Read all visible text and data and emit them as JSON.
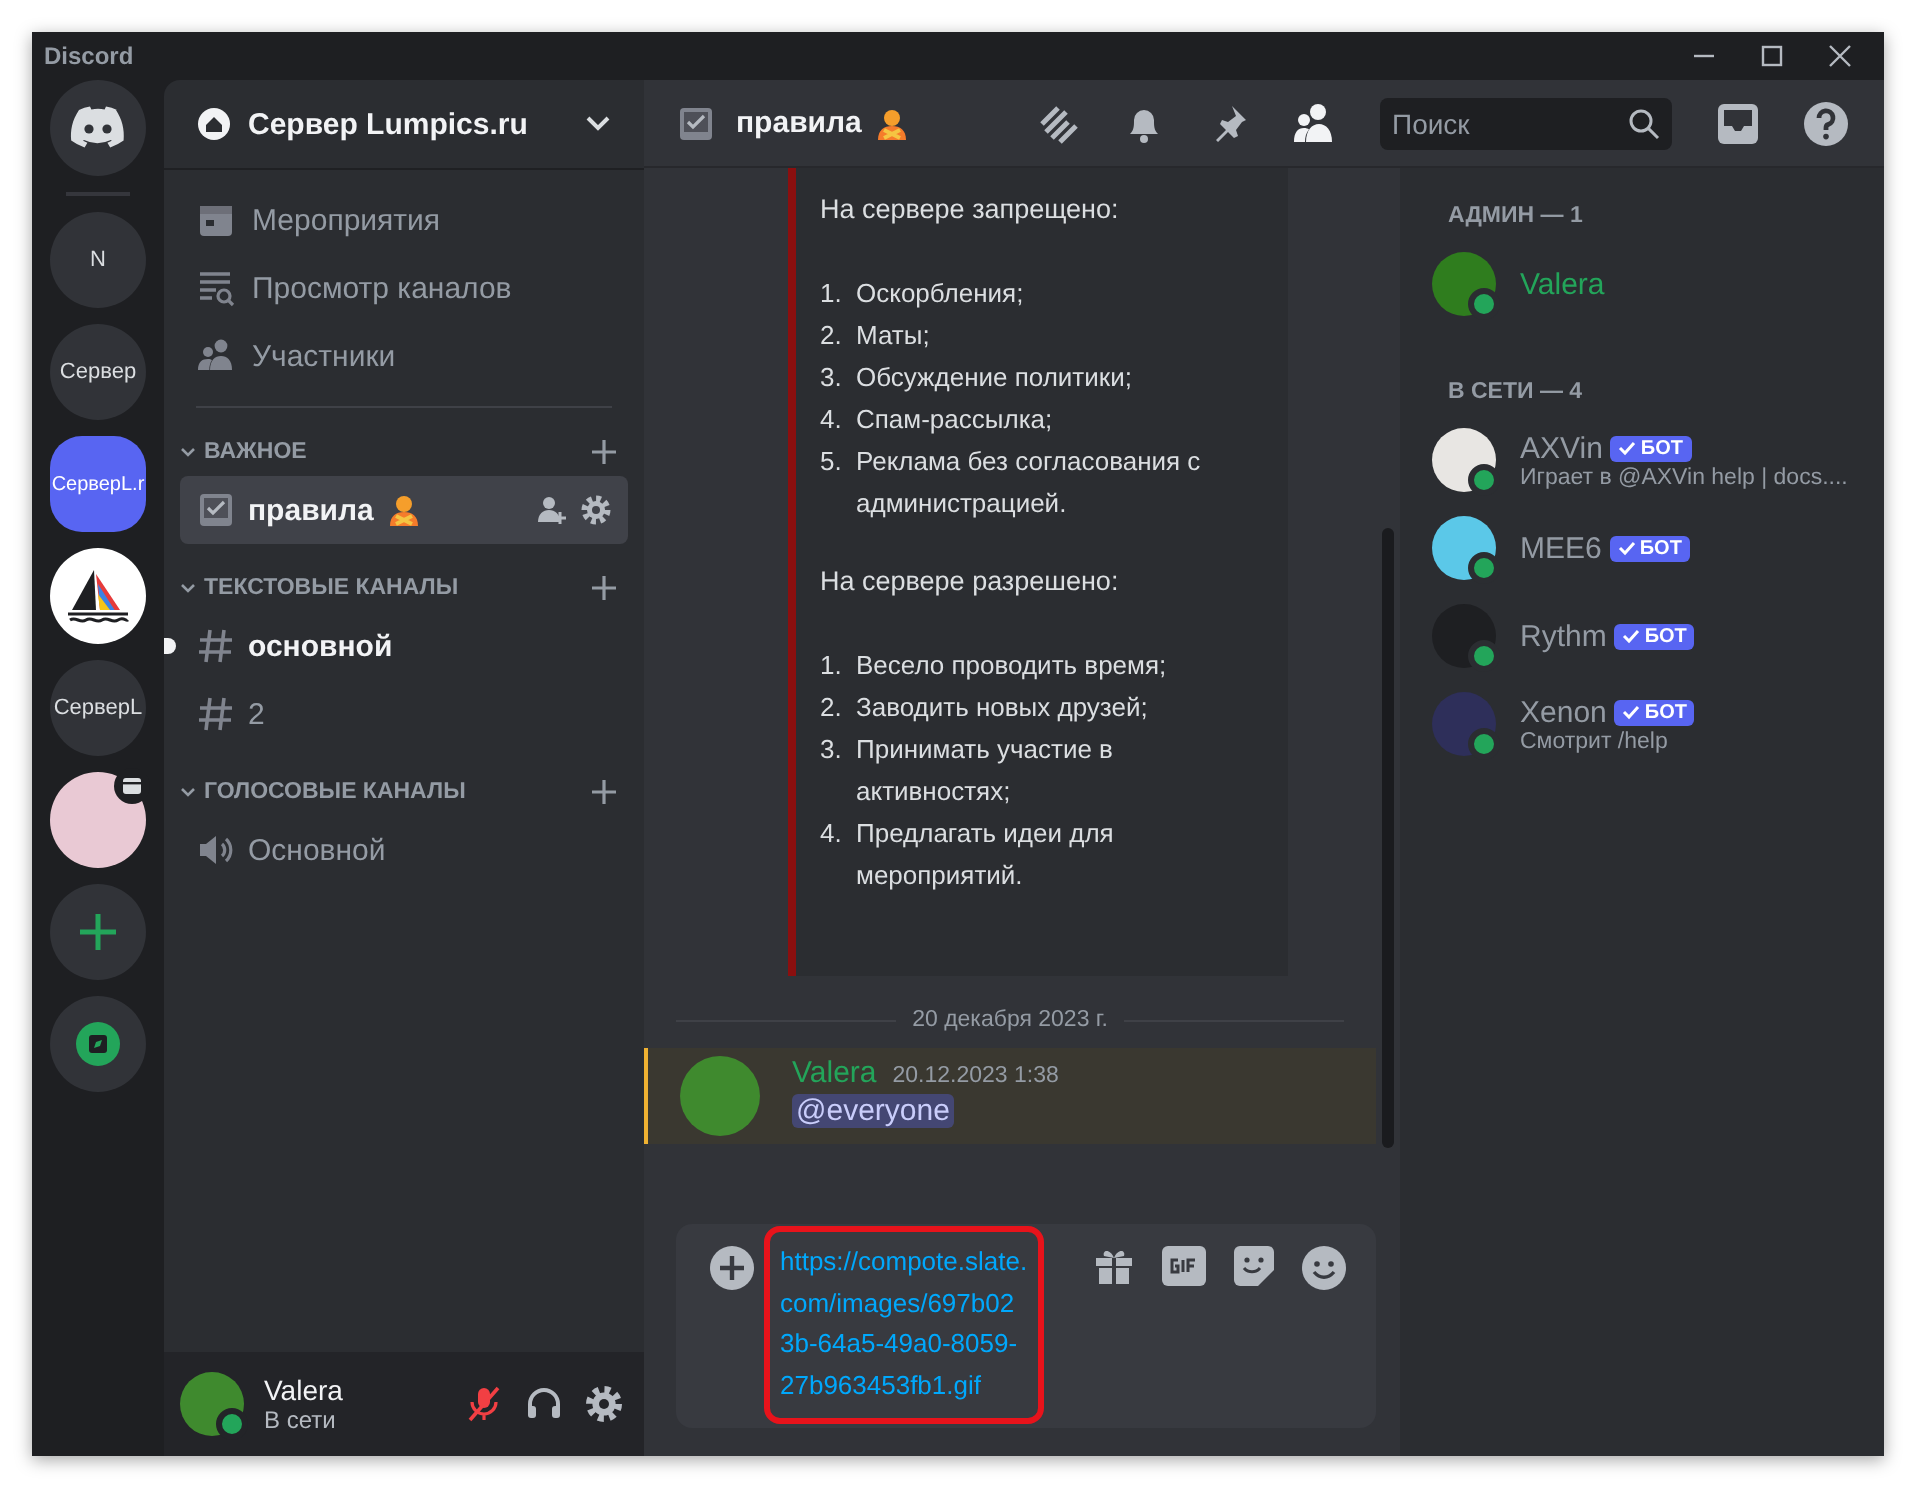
{
  "window": {
    "title": "Discord"
  },
  "servers": [
    {
      "kind": "home",
      "selected": false
    },
    {
      "kind": "text",
      "label": "N",
      "selected": false
    },
    {
      "kind": "text",
      "label": "Сервер",
      "selected": false
    },
    {
      "kind": "text",
      "label": "СерверL.r",
      "selected": true
    },
    {
      "kind": "image",
      "selected": false
    },
    {
      "kind": "text",
      "label": "СерверL",
      "selected": false
    },
    {
      "kind": "avatar",
      "selected": false
    },
    {
      "kind": "add",
      "selected": false
    },
    {
      "kind": "explore",
      "selected": false
    }
  ],
  "server_header": {
    "name": "Сервер Lumpics.ru"
  },
  "nav_items": [
    {
      "kind": "events",
      "label": "Мероприятия"
    },
    {
      "kind": "browse",
      "label": "Просмотр каналов"
    },
    {
      "kind": "members",
      "label": "Участники"
    }
  ],
  "categories": [
    {
      "name": "ВАЖНОЕ",
      "expanded": true,
      "channels": [
        {
          "kind": "rules",
          "name": "правила",
          "selected": true,
          "unread": false
        }
      ]
    },
    {
      "name": "ТЕКСТОВЫЕ КАНАЛЫ",
      "expanded": true,
      "channels": [
        {
          "kind": "text",
          "name": "основной",
          "selected": false,
          "unread": true
        },
        {
          "kind": "text",
          "name": "2",
          "selected": false,
          "unread": false
        }
      ]
    },
    {
      "name": "ГОЛОСОВЫЕ КАНАЛЫ",
      "expanded": true,
      "channels": [
        {
          "kind": "voice",
          "name": "Основной",
          "selected": false,
          "unread": false
        }
      ]
    }
  ],
  "user_panel": {
    "name": "Valera",
    "status": "В сети",
    "muted": true
  },
  "chat_header": {
    "channel": "правила",
    "search": {
      "placeholder": "Поиск"
    }
  },
  "embed": [
    {
      "kind": "heading",
      "text": "На сервере запрещено:"
    },
    {
      "kind": "list",
      "items": [
        {
          "num": "1.",
          "text": "Оскорбления;"
        },
        {
          "num": "2.",
          "text": "Маты;"
        },
        {
          "num": "3.",
          "text": "Обсуждение политики;"
        },
        {
          "num": "4.",
          "text": "Спам-рассылка;"
        },
        {
          "num": "5.",
          "text": "Реклама без согласования с администрацией."
        }
      ]
    },
    {
      "kind": "heading",
      "text": "На сервере разрешено:"
    },
    {
      "kind": "list",
      "items": [
        {
          "num": "1.",
          "text": "Весело проводить время;"
        },
        {
          "num": "2.",
          "text": "Заводить новых друзей;"
        },
        {
          "num": "3.",
          "text": "Принимать участие в активностях;"
        },
        {
          "num": "4.",
          "text": "Предлагать идеи для мероприятий."
        }
      ]
    }
  ],
  "date_divider": "20 декабря 2023 г.",
  "message": {
    "author": "Valera",
    "time": "20.12.2023 1:38",
    "text": "@everyone",
    "mentioned": true
  },
  "composer": {
    "value": "https://compote.slate.com/images/697b023b-64a5-49a0-8059-27b963453fb1.gif",
    "highlighted": true
  },
  "member_groups": [
    {
      "title": "АДМИН — 1",
      "members": [
        {
          "name": "Valera",
          "color": "#23a55a"
        }
      ]
    },
    {
      "title": "В СЕТИ — 4",
      "members": [
        {
          "name": "AXVin",
          "color": "#949ba4",
          "badge": "БОТ",
          "activity": "Играет в @AXVin help | docs...."
        },
        {
          "name": "MEE6",
          "color": "#949ba4",
          "badge": "БОТ"
        },
        {
          "name": "Rythm",
          "color": "#949ba4",
          "badge": "БОТ"
        },
        {
          "name": "Xenon",
          "color": "#949ba4",
          "badge": "БОТ",
          "activity": "Смотрит /help"
        }
      ]
    }
  ]
}
